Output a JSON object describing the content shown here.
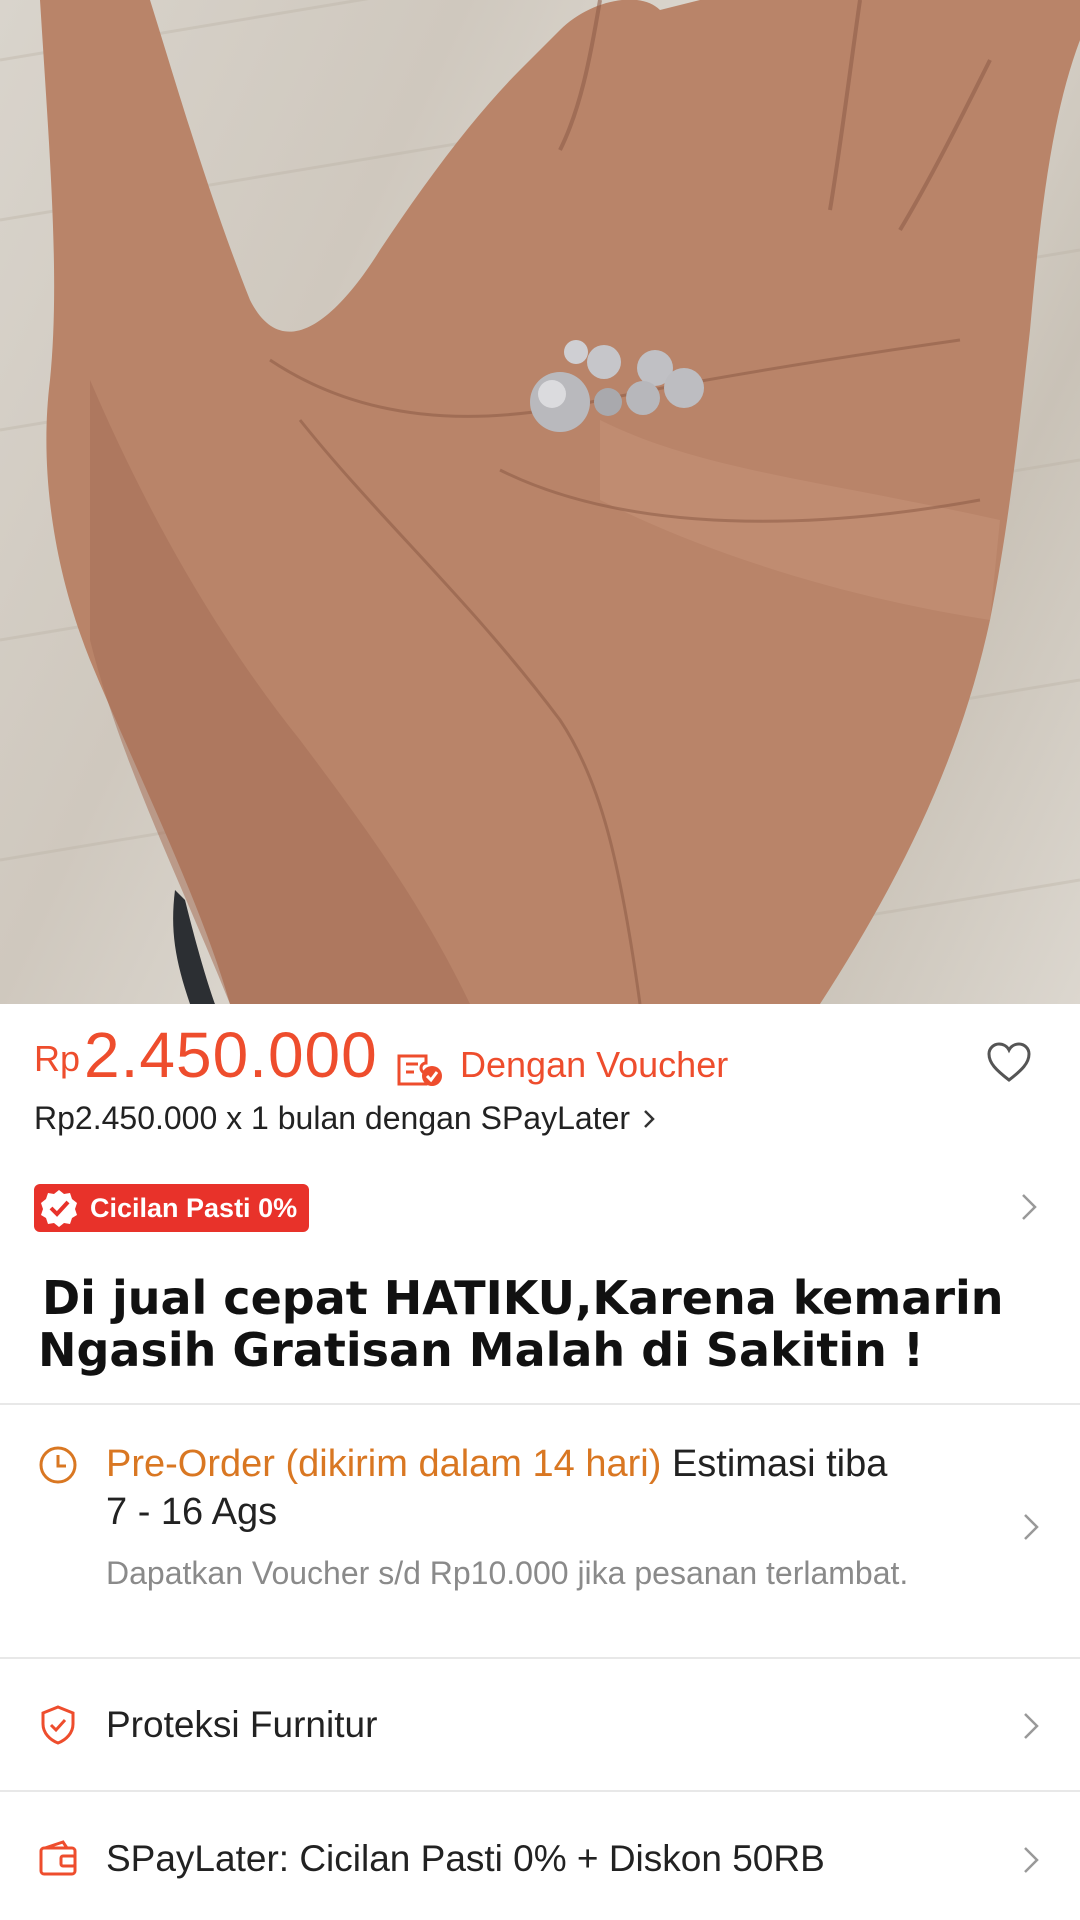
{
  "product_image": {
    "description_icon": "product-photo"
  },
  "price": {
    "currency": "Rp",
    "amount": "2.450.000",
    "voucher_label": "Dengan Voucher",
    "installment_text": "Rp2.450.000 x 1 bulan dengan SPayLater",
    "accent_color": "#ee4d2d"
  },
  "badge": {
    "label": "Cicilan Pasti 0%",
    "color": "#e8322a"
  },
  "title": {
    "line1": "Di jual cepat HATIKU,Karena kemarin",
    "line2": "Ngasih Gratisan Malah di Sakitin !"
  },
  "shipping": {
    "preorder": "Pre-Order (dikirim dalam 14 hari)",
    "estimate_label": "Estimasi tiba",
    "estimate_dates": "7 - 16 Ags",
    "voucher_note": "Dapatkan Voucher s/d Rp10.000 jika pesanan terlambat.",
    "accent_color": "#d97722"
  },
  "protection": {
    "label": "Proteksi Furnitur"
  },
  "spaylater": {
    "label": "SPayLater: Cicilan Pasti 0% + Diskon 50RB"
  }
}
